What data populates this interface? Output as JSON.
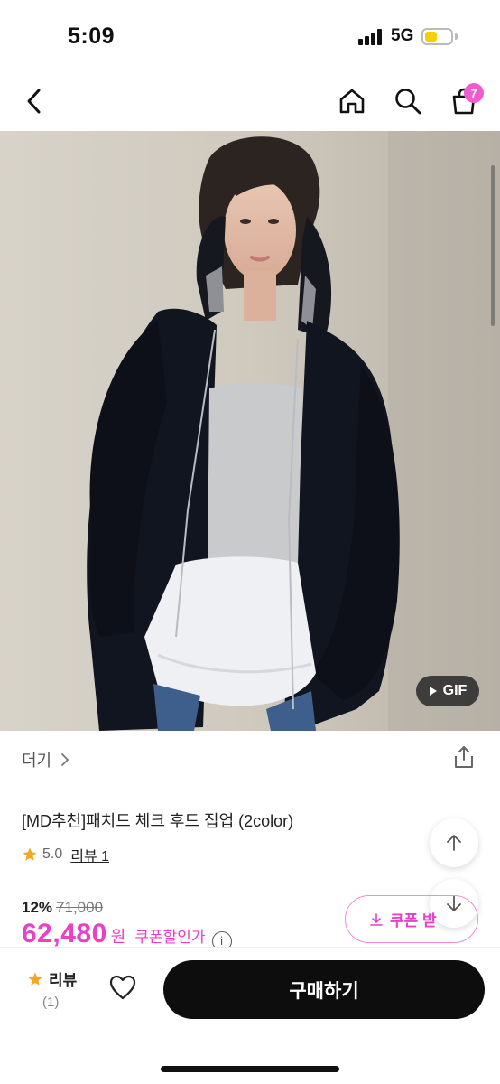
{
  "status": {
    "time": "5:09",
    "network": "5G"
  },
  "nav": {
    "cart_count": "7"
  },
  "media": {
    "badge": "GIF"
  },
  "product": {
    "brand": "더기",
    "title": "[MD추천]패치드 체크 후드 집업 (2color)",
    "rating": "5.0",
    "review_link": "리뷰 1",
    "discount_rate": "12%",
    "original_price": "71,000",
    "price": "62,480",
    "currency": "원",
    "coupon_price_label": "쿠폰할인가",
    "coupon_button": "쿠폰 받"
  },
  "bottom": {
    "review_label": "리뷰",
    "review_count": "(1)",
    "buy_label": "구매하기"
  },
  "colors": {
    "accent": "#ea3fc7",
    "badge": "#f05bd0",
    "star": "#f5a623"
  }
}
